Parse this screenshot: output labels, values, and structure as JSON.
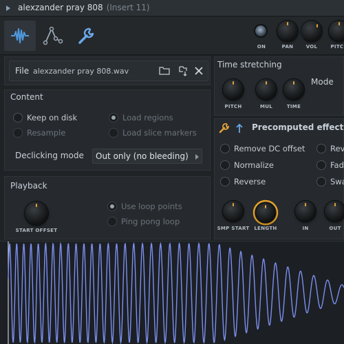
{
  "window": {
    "title": "alexzander pray 808",
    "insert": "(Insert 11)"
  },
  "toolbar": {
    "tabs": [
      {
        "name": "waveform-icon",
        "active": true
      },
      {
        "name": "envelope-icon",
        "active": false
      },
      {
        "name": "wrench-icon",
        "active": false
      }
    ],
    "knobs": [
      {
        "label": "ON"
      },
      {
        "label": "PAN"
      },
      {
        "label": "VOL"
      },
      {
        "label": "PITCH"
      }
    ]
  },
  "file": {
    "label": "File",
    "name": "alexzander pray 808.wav"
  },
  "content": {
    "title": "Content",
    "keep_on_disk": "Keep on disk",
    "resample": "Resample",
    "load_regions": "Load regions",
    "load_slice_markers": "Load slice markers",
    "declicking_label": "Declicking mode",
    "declicking_value": "Out only (no bleeding)"
  },
  "playback": {
    "title": "Playback",
    "start_offset": "START OFFSET",
    "use_loop_points": "Use loop points",
    "ping_pong_loop": "Ping pong loop"
  },
  "time_stretching": {
    "title": "Time stretching",
    "mode_label": "Mode",
    "knobs": [
      "PITCH",
      "MUL",
      "TIME"
    ]
  },
  "precomputed": {
    "title": "Precomputed effects",
    "left": [
      "Remove DC offset",
      "Normalize",
      "Reverse"
    ],
    "right": [
      "Reve",
      "Fade",
      "Swa"
    ],
    "knobs": [
      "SMP START",
      "LENGTH",
      "IN",
      "OUT"
    ]
  },
  "colors": {
    "accent": "#e3a23b",
    "waveform": "#7c8ff0",
    "vol_ring": "#3fb6e8",
    "length_ring": "#e8a42a"
  }
}
